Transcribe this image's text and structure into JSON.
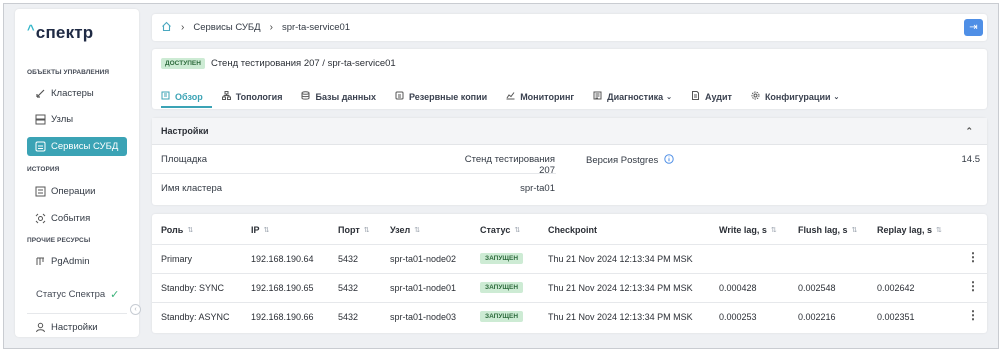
{
  "sidebar": {
    "logo": "спектр",
    "sections": {
      "objects": "ОБЪЕКТЫ УПРАВЛЕНИЯ",
      "history": "ИСТОРИЯ",
      "other": "ПРОЧИЕ РЕСУРСЫ"
    },
    "items": [
      {
        "label": "Кластеры",
        "icon": "cluster-icon"
      },
      {
        "label": "Узлы",
        "icon": "server-icon"
      },
      {
        "label": "Сервисы СУБД",
        "icon": "database-service-icon"
      },
      {
        "label": "Операции",
        "icon": "operations-icon"
      },
      {
        "label": "События",
        "icon": "events-icon"
      },
      {
        "label": "PgAdmin",
        "icon": "pgadmin-icon"
      }
    ],
    "status_label": "Статус Спектра",
    "settings_label": "Настройки"
  },
  "breadcrumb": {
    "items": [
      "Сервисы СУБД",
      "spr-ta-service01"
    ]
  },
  "service": {
    "status": "ДОСТУПЕН",
    "title": "Стенд тестирования 207 /  spr-ta-service01"
  },
  "tabs": [
    {
      "label": "Обзор",
      "icon": "overview-icon",
      "dropdown": false
    },
    {
      "label": "Топология",
      "icon": "topology-icon",
      "dropdown": false
    },
    {
      "label": "Базы данных",
      "icon": "database-icon",
      "dropdown": false
    },
    {
      "label": "Резервные копии",
      "icon": "backup-icon",
      "dropdown": false
    },
    {
      "label": "Мониторинг",
      "icon": "monitoring-icon",
      "dropdown": false
    },
    {
      "label": "Диагностика",
      "icon": "diagnostics-icon",
      "dropdown": true
    },
    {
      "label": "Аудит",
      "icon": "audit-icon",
      "dropdown": false
    },
    {
      "label": "Конфигурации",
      "icon": "config-icon",
      "dropdown": true
    }
  ],
  "settings": {
    "title": "Настройки",
    "platform_label": "Площадка",
    "platform_value": "Стенд тестирования 207",
    "cluster_label": "Имя кластера",
    "cluster_value": "spr-ta01",
    "pg_label": "Версия Postgres",
    "pg_value": "14.5"
  },
  "table": {
    "headers": [
      "Роль",
      "IP",
      "Порт",
      "Узел",
      "Статус",
      "Checkpoint",
      "Write lag, s",
      "Flush lag, s",
      "Replay lag, s"
    ],
    "rows": [
      {
        "role": "Primary",
        "ip": "192.168.190.64",
        "port": "5432",
        "node": "spr-ta01-node02",
        "status": "ЗАПУЩЕН",
        "checkpoint": "Thu 21 Nov 2024 12:13:34 PM MSK",
        "write": "",
        "flush": "",
        "replay": ""
      },
      {
        "role": "Standby: SYNC",
        "ip": "192.168.190.65",
        "port": "5432",
        "node": "spr-ta01-node01",
        "status": "ЗАПУЩЕН",
        "checkpoint": "Thu 21 Nov 2024 12:13:34 PM MSK",
        "write": "0.000428",
        "flush": "0.002548",
        "replay": "0.002642"
      },
      {
        "role": "Standby: ASYNC",
        "ip": "192.168.190.66",
        "port": "5432",
        "node": "spr-ta01-node03",
        "status": "ЗАПУЩЕН",
        "checkpoint": "Thu 21 Nov 2024 12:13:34 PM MSK",
        "write": "0.000253",
        "flush": "0.002216",
        "replay": "0.002351"
      }
    ]
  },
  "colors": {
    "accent": "#3ba3b5",
    "status_green_bg": "#cdebd4",
    "exit_button": "#4f8fe6"
  }
}
